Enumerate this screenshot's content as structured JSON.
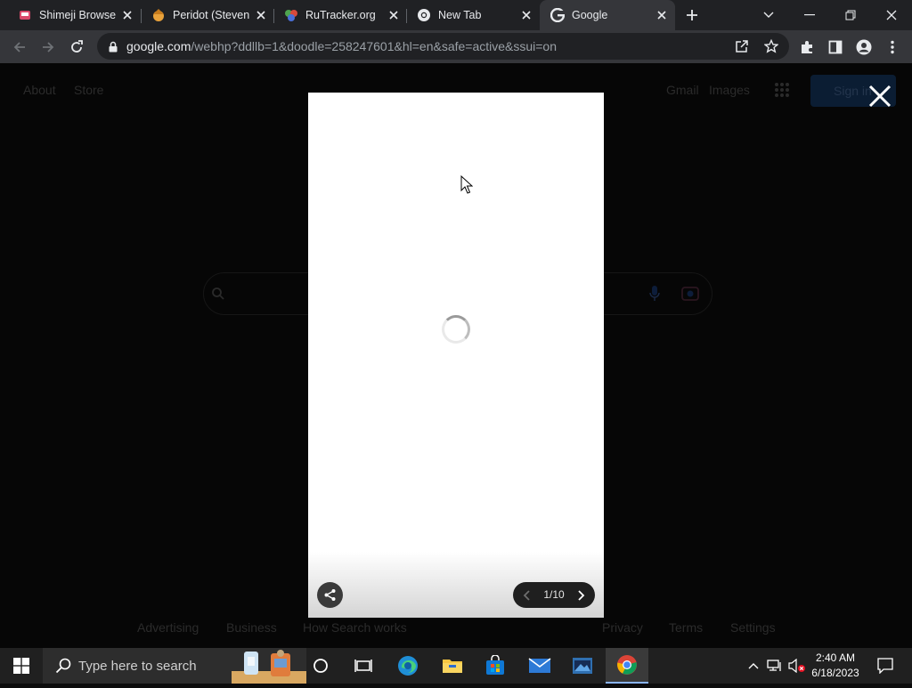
{
  "browser": {
    "tabs": [
      {
        "title": "Shimeji Browser",
        "icon": "shimeji-favicon"
      },
      {
        "title": "Peridot (Steven",
        "icon": "peridot-favicon"
      },
      {
        "title": "RuTracker.org",
        "icon": "rutracker-favicon"
      },
      {
        "title": "New Tab",
        "icon": "chrome-favicon"
      },
      {
        "title": "Google",
        "icon": "google-favicon",
        "active": true
      }
    ],
    "new_tab_icon": "plus-icon",
    "address": {
      "host": "google.com",
      "path": "/webhp?ddllb=1&doodle=258247601&hl=en&safe=active&ssui=on"
    }
  },
  "page": {
    "header_left": [
      "About",
      "Store"
    ],
    "header_right": [
      "Gmail",
      "Images"
    ],
    "sign_in": "Sign in",
    "footer_left": [
      "Advertising",
      "Business",
      "How Search works"
    ],
    "footer_right": [
      "Privacy",
      "Terms",
      "Settings"
    ]
  },
  "viewer": {
    "page_count": "1/10",
    "state": "loading"
  },
  "taskbar": {
    "search_placeholder": "Type here to search",
    "apps": [
      "cortana-icon",
      "task-view-icon",
      "edge-icon",
      "file-explorer-icon",
      "store-icon",
      "mail-icon",
      "video-editor-icon",
      "chrome-icon"
    ],
    "time": "2:40 AM",
    "date": "6/18/2023"
  },
  "colors": {
    "chrome_dark": "#202124",
    "toolbar": "#35363a",
    "viewer_bg": "#ffffff",
    "taskbar": "#202020",
    "accent": "#8ab4f8"
  }
}
